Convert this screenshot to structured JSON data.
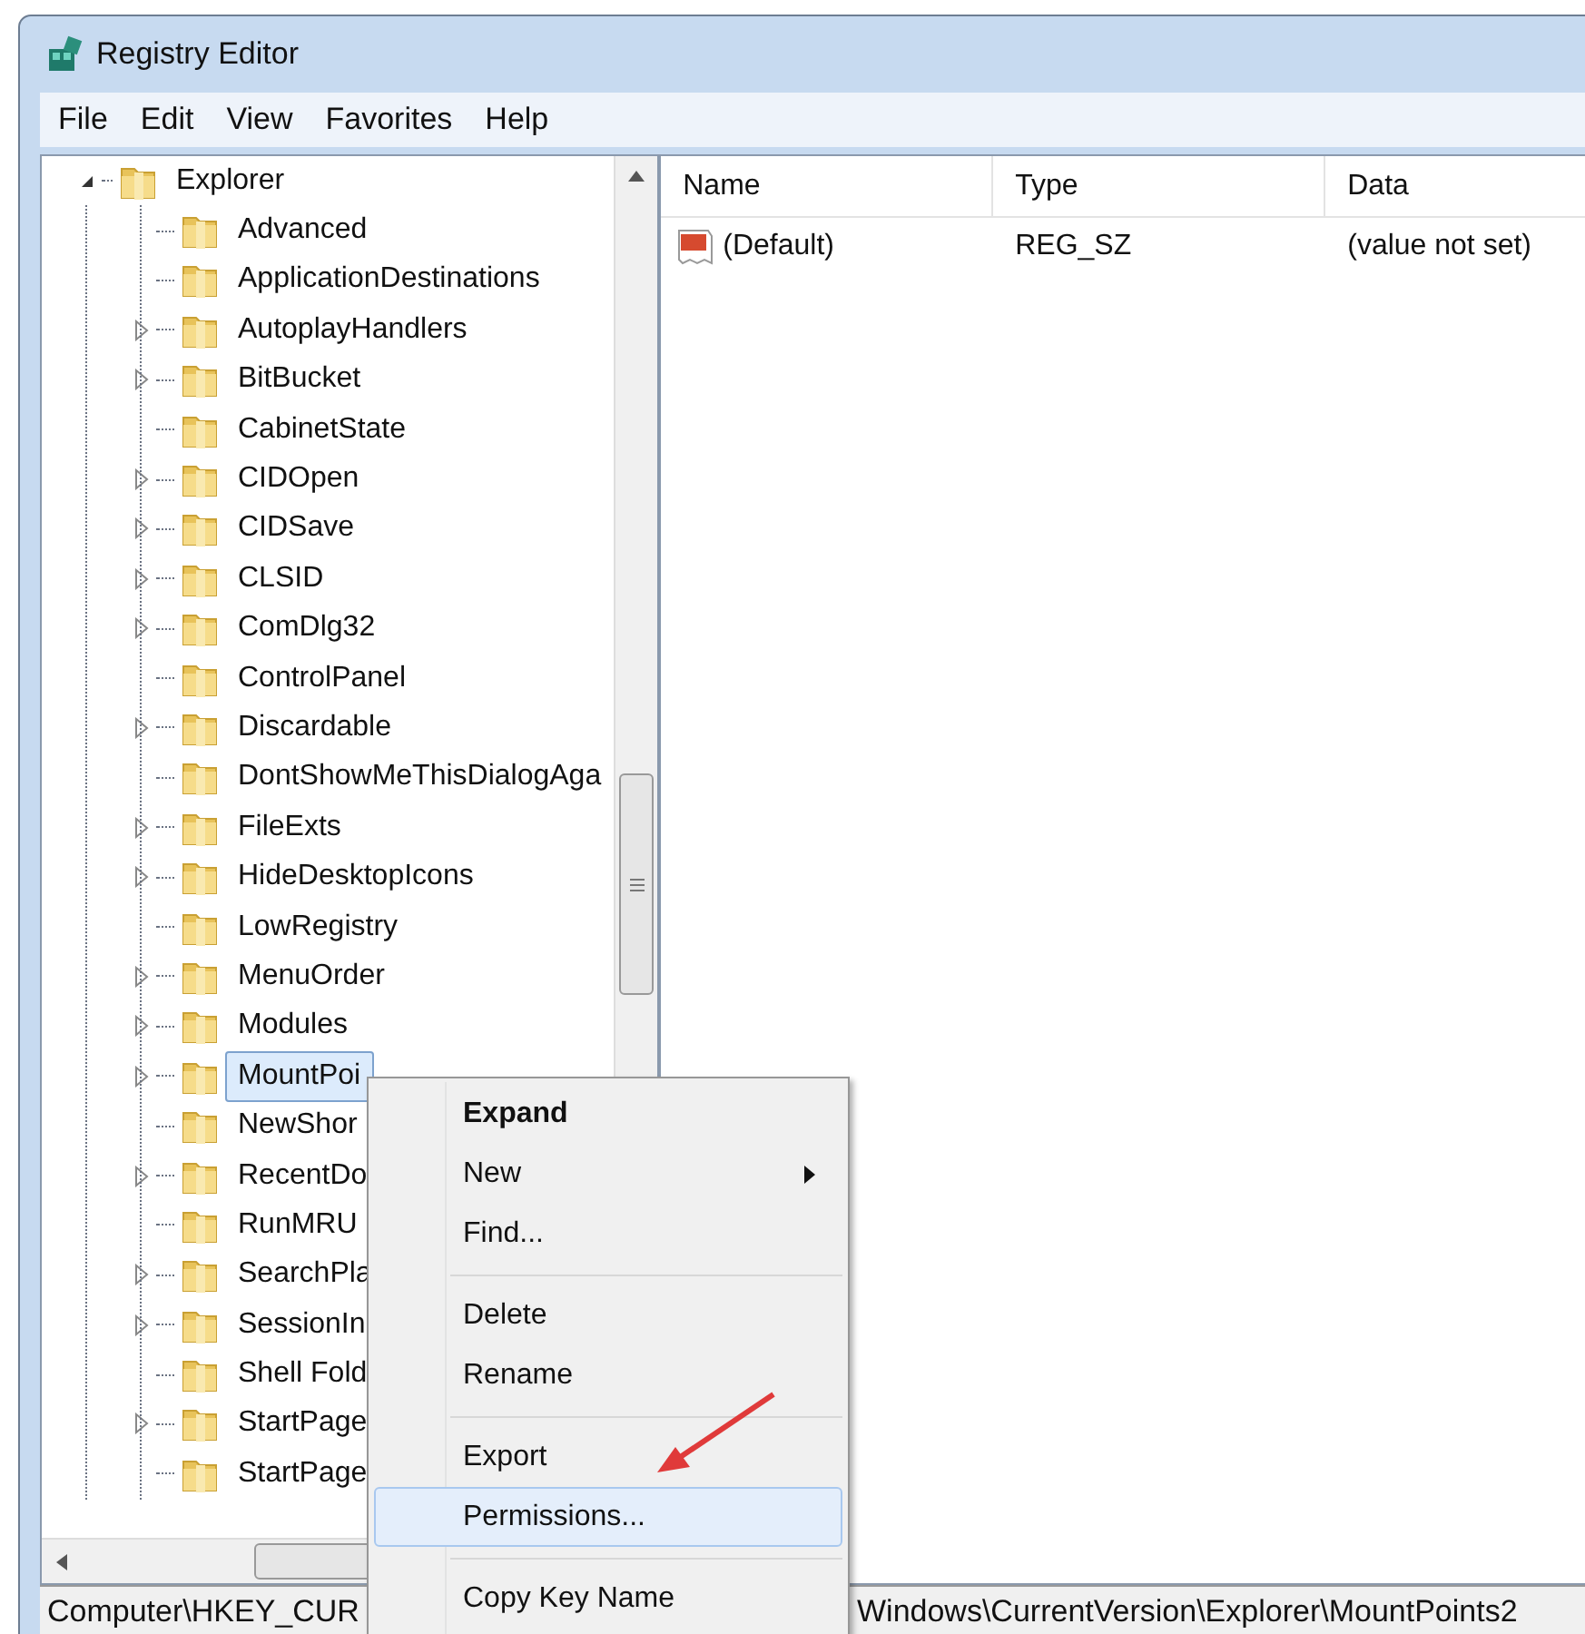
{
  "window": {
    "title": "Registry Editor"
  },
  "menu_bar": [
    "File",
    "Edit",
    "View",
    "Favorites",
    "Help"
  ],
  "tree": {
    "label": "Explorer",
    "expanded": true,
    "selected": false,
    "children": [
      {
        "label": "Advanced",
        "has_children": false,
        "selected": false
      },
      {
        "label": "ApplicationDestinations",
        "has_children": false,
        "selected": false
      },
      {
        "label": "AutoplayHandlers",
        "has_children": true,
        "selected": false
      },
      {
        "label": "BitBucket",
        "has_children": true,
        "selected": false
      },
      {
        "label": "CabinetState",
        "has_children": false,
        "selected": false
      },
      {
        "label": "CIDOpen",
        "has_children": true,
        "selected": false
      },
      {
        "label": "CIDSave",
        "has_children": true,
        "selected": false
      },
      {
        "label": "CLSID",
        "has_children": true,
        "selected": false
      },
      {
        "label": "ComDlg32",
        "has_children": true,
        "selected": false
      },
      {
        "label": "ControlPanel",
        "has_children": false,
        "selected": false
      },
      {
        "label": "Discardable",
        "has_children": true,
        "selected": false
      },
      {
        "label": "DontShowMeThisDialogAga",
        "has_children": false,
        "selected": false
      },
      {
        "label": "FileExts",
        "has_children": true,
        "selected": false
      },
      {
        "label": "HideDesktopIcons",
        "has_children": true,
        "selected": false
      },
      {
        "label": "LowRegistry",
        "has_children": false,
        "selected": false
      },
      {
        "label": "MenuOrder",
        "has_children": true,
        "selected": false
      },
      {
        "label": "Modules",
        "has_children": true,
        "selected": false
      },
      {
        "label": "MountPoi",
        "has_children": true,
        "selected": true
      },
      {
        "label": "NewShor",
        "has_children": false,
        "selected": false
      },
      {
        "label": "RecentDo",
        "has_children": true,
        "selected": false
      },
      {
        "label": "RunMRU",
        "has_children": false,
        "selected": false
      },
      {
        "label": "SearchPla",
        "has_children": true,
        "selected": false
      },
      {
        "label": "SessionIn",
        "has_children": true,
        "selected": false
      },
      {
        "label": "Shell Fold",
        "has_children": false,
        "selected": false
      },
      {
        "label": "StartPage",
        "has_children": true,
        "selected": false
      },
      {
        "label": "StartPage",
        "has_children": false,
        "selected": false
      }
    ]
  },
  "values": {
    "columns": [
      "Name",
      "Type",
      "Data"
    ],
    "rows": [
      {
        "name": "(Default)",
        "type": "REG_SZ",
        "data": "(value not set)"
      }
    ]
  },
  "context_menu": [
    {
      "kind": "item",
      "label": "Expand",
      "bold": true,
      "submenu": false,
      "selected": false
    },
    {
      "kind": "item",
      "label": "New",
      "bold": false,
      "submenu": true,
      "selected": false
    },
    {
      "kind": "item",
      "label": "Find...",
      "bold": false,
      "submenu": false,
      "selected": false
    },
    {
      "kind": "separator"
    },
    {
      "kind": "item",
      "label": "Delete",
      "bold": false,
      "submenu": false,
      "selected": false
    },
    {
      "kind": "item",
      "label": "Rename",
      "bold": false,
      "submenu": false,
      "selected": false
    },
    {
      "kind": "separator"
    },
    {
      "kind": "item",
      "label": "Export",
      "bold": false,
      "submenu": false,
      "selected": false
    },
    {
      "kind": "item",
      "label": "Permissions...",
      "bold": false,
      "submenu": false,
      "selected": true
    },
    {
      "kind": "separator"
    },
    {
      "kind": "item",
      "label": "Copy Key Name",
      "bold": false,
      "submenu": false,
      "selected": false
    }
  ],
  "status_bar": [
    "Computer\\HKEY_CUR",
    "Windows\\CurrentVersion\\Explorer\\MountPoints2"
  ]
}
